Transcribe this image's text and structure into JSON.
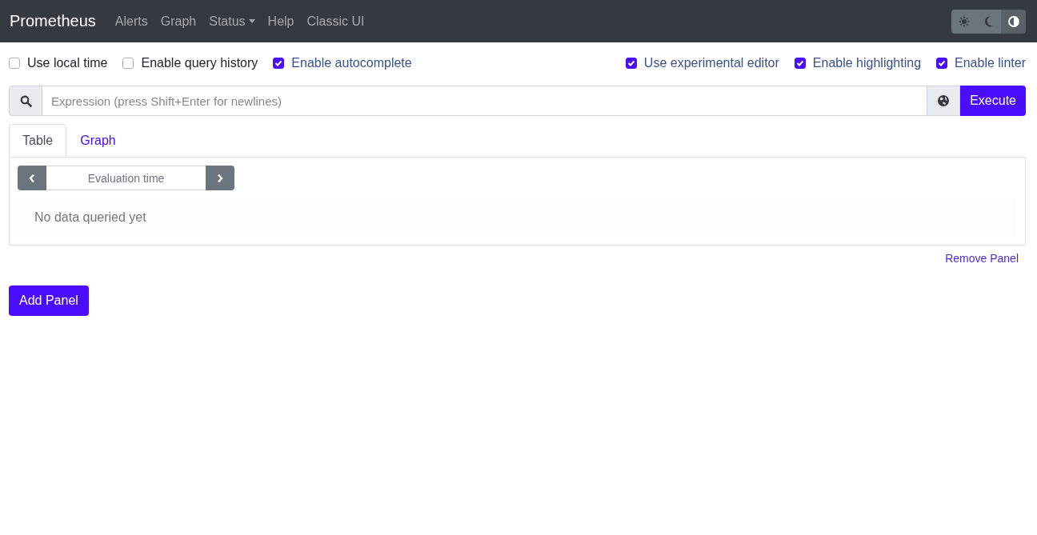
{
  "navbar": {
    "brand": "Prometheus",
    "links": [
      {
        "label": "Alerts",
        "dropdown": false
      },
      {
        "label": "Graph",
        "dropdown": false
      },
      {
        "label": "Status",
        "dropdown": true
      },
      {
        "label": "Help",
        "dropdown": false
      },
      {
        "label": "Classic UI",
        "dropdown": false
      }
    ],
    "theme_buttons": [
      {
        "kind": "light",
        "selected": false
      },
      {
        "kind": "dark",
        "selected": false
      },
      {
        "kind": "auto",
        "selected": true
      }
    ]
  },
  "options_left": [
    {
      "label": "Use local time",
      "checked": false
    },
    {
      "label": "Enable query history",
      "checked": false
    },
    {
      "label": "Enable autocomplete",
      "checked": true
    }
  ],
  "options_right": [
    {
      "label": "Use experimental editor",
      "checked": true
    },
    {
      "label": "Enable highlighting",
      "checked": true
    },
    {
      "label": "Enable linter",
      "checked": true
    }
  ],
  "query": {
    "placeholder": "Expression (press Shift+Enter for newlines)",
    "execute": "Execute"
  },
  "panel": {
    "tabs": [
      {
        "label": "Table",
        "selected": true
      },
      {
        "label": "Graph",
        "selected": false
      }
    ],
    "evaluation_time": {
      "placeholder": "Evaluation time"
    },
    "message": "No data queried yet",
    "remove": "Remove Panel"
  },
  "add_panel": "Add Panel"
}
